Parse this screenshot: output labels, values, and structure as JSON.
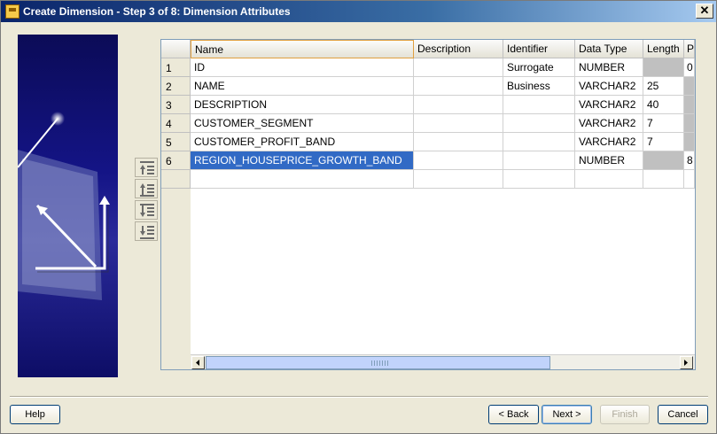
{
  "window": {
    "title": "Create Dimension - Step 3 of 8: Dimension Attributes",
    "close_label": "✕"
  },
  "grid": {
    "columns": [
      "Name",
      "Description",
      "Identifier",
      "Data Type",
      "Length",
      "P"
    ],
    "rows": [
      {
        "num": "1",
        "name": "ID",
        "description": "",
        "identifier": "Surrogate",
        "data_type": "NUMBER",
        "length": "",
        "p": "0"
      },
      {
        "num": "2",
        "name": "NAME",
        "description": "",
        "identifier": "Business",
        "data_type": "VARCHAR2",
        "length": "25",
        "p": ""
      },
      {
        "num": "3",
        "name": "DESCRIPTION",
        "description": "",
        "identifier": "",
        "data_type": "VARCHAR2",
        "length": "40",
        "p": ""
      },
      {
        "num": "4",
        "name": "CUSTOMER_SEGMENT",
        "description": "",
        "identifier": "",
        "data_type": "VARCHAR2",
        "length": "7",
        "p": ""
      },
      {
        "num": "5",
        "name": "CUSTOMER_PROFIT_BAND",
        "description": "",
        "identifier": "",
        "data_type": "VARCHAR2",
        "length": "7",
        "p": ""
      },
      {
        "num": "6",
        "name": "REGION_HOUSEPRICE_GROWTH_BAND",
        "description": "",
        "identifier": "",
        "data_type": "NUMBER",
        "length": "",
        "p": "8"
      }
    ]
  },
  "reorder_buttons": [
    "move-to-top",
    "move-up",
    "move-down",
    "move-to-bottom"
  ],
  "buttons": {
    "help": "Help",
    "back": "< Back",
    "next": "Next >",
    "finish": "Finish",
    "cancel": "Cancel"
  }
}
